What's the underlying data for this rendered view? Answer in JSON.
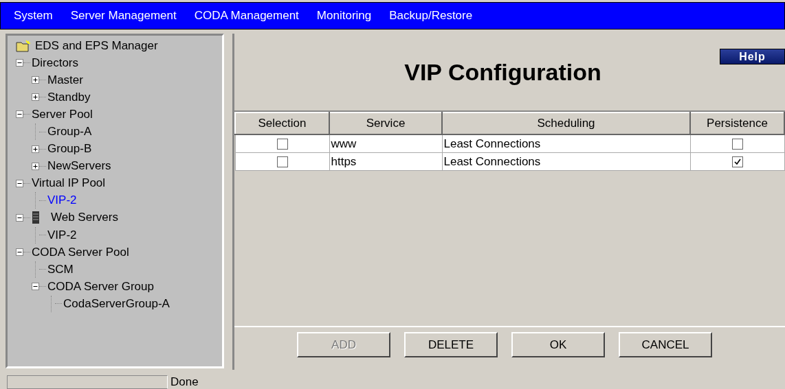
{
  "menu": [
    {
      "label": "System"
    },
    {
      "label": "Server Management"
    },
    {
      "label": "CODA Management"
    },
    {
      "label": "Monitoring"
    },
    {
      "label": "Backup/Restore"
    }
  ],
  "tree": {
    "label": "EDS and EPS Manager",
    "kind": "folder",
    "children": [
      {
        "label": "Directors",
        "expanded": true,
        "selected": false,
        "children": [
          {
            "label": "Master",
            "expanded": false,
            "selected": false
          },
          {
            "label": "Standby",
            "expanded": false,
            "selected": false
          }
        ]
      },
      {
        "label": "Server Pool",
        "expanded": true,
        "selected": false,
        "children": [
          {
            "label": "Group-A",
            "selected": false
          },
          {
            "label": "Group-B",
            "expanded": false,
            "selected": false
          },
          {
            "label": "NewServers",
            "expanded": false,
            "selected": false
          }
        ]
      },
      {
        "label": "Virtual IP Pool",
        "expanded": true,
        "selected": false,
        "children": [
          {
            "label": "VIP-2",
            "selected": true
          }
        ]
      },
      {
        "label": "Web Servers",
        "kind": "server",
        "expanded": true,
        "selected": false,
        "children": [
          {
            "label": "VIP-2",
            "selected": false
          }
        ]
      },
      {
        "label": "CODA Server Pool",
        "expanded": true,
        "selected": false,
        "children": [
          {
            "label": "SCM",
            "selected": false
          },
          {
            "label": "CODA Server Group",
            "expanded": true,
            "selected": false,
            "children": [
              {
                "label": "CodaServerGroup-A",
                "selected": false
              }
            ]
          }
        ]
      }
    ]
  },
  "title": "VIP Configuration",
  "help_button": "Help",
  "table": {
    "columns": [
      "Selection",
      "Service",
      "Scheduling",
      "Persistence"
    ],
    "rows": [
      {
        "selected": false,
        "service": "www",
        "scheduling": "Least Connections",
        "persistence": false
      },
      {
        "selected": false,
        "service": "https",
        "scheduling": "Least Connections",
        "persistence": true
      }
    ]
  },
  "buttons": [
    {
      "label": "ADD",
      "disabled": true
    },
    {
      "label": "DELETE",
      "disabled": false
    },
    {
      "label": "OK",
      "disabled": false
    },
    {
      "label": "CANCEL",
      "disabled": false
    }
  ],
  "status_bar": {
    "text": "Done"
  }
}
